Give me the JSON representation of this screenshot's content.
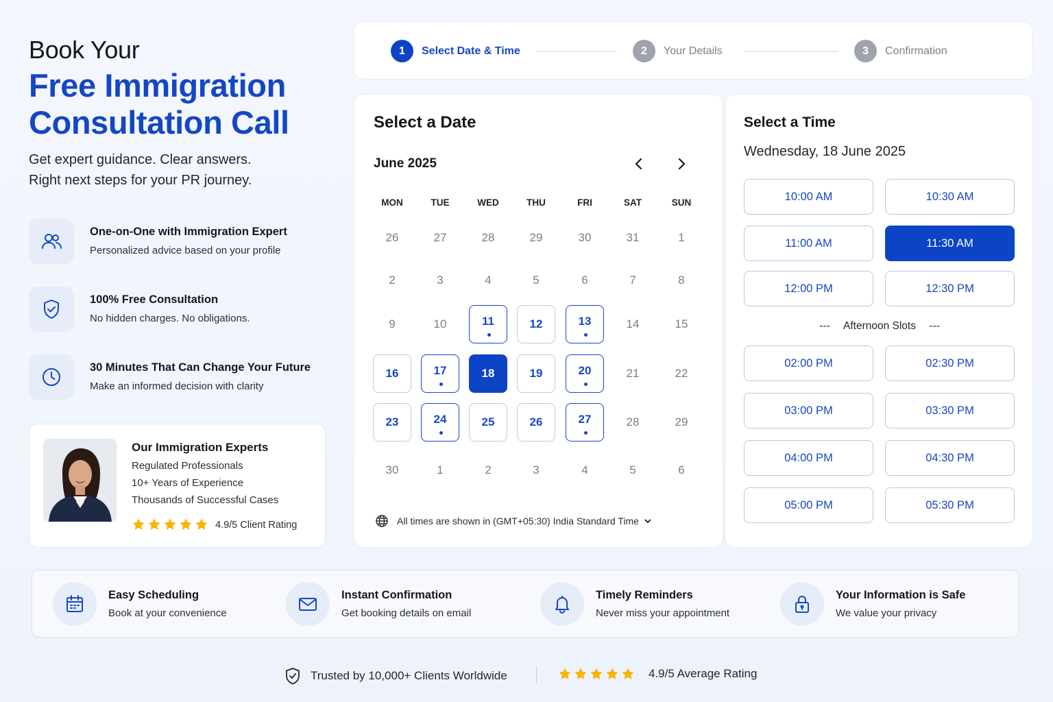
{
  "hero": {
    "pre_title": "Book Your",
    "title_line1": "Free Immigration",
    "title_line2": "Consultation Call",
    "subtitle_line1": "Get expert guidance. Clear answers.",
    "subtitle_line2": "Right next steps for your PR journey."
  },
  "features": [
    {
      "icon": "users-icon",
      "title": "One-on-One with Immigration Expert",
      "desc": "Personalized advice based on your profile"
    },
    {
      "icon": "shield-check-icon",
      "title": "100% Free Consultation",
      "desc": "No hidden charges. No obligations."
    },
    {
      "icon": "clock-icon",
      "title": "30 Minutes That Can Change Your Future",
      "desc": "Make an informed decision with clarity"
    }
  ],
  "experts": {
    "title": "Our Immigration Experts",
    "lines": [
      "Regulated Professionals",
      "10+ Years of Experience",
      "Thousands of Successful Cases"
    ],
    "stars": 5,
    "rating": "4.9/5 Client Rating"
  },
  "stepper": {
    "steps": [
      {
        "num": "1",
        "label": "Select Date & Time",
        "active": true
      },
      {
        "num": "2",
        "label": "Your Details",
        "active": false
      },
      {
        "num": "3",
        "label": "Confirmation",
        "active": false
      }
    ]
  },
  "calendar": {
    "title": "Select a Date",
    "month": "June 2025",
    "weekdays": [
      "MON",
      "TUE",
      "WED",
      "THU",
      "FRI",
      "SAT",
      "SUN"
    ],
    "weeks": [
      [
        "26",
        "27",
        "28",
        "29",
        "30",
        "31",
        "1"
      ],
      [
        "2",
        "3",
        "4",
        "5",
        "6",
        "7",
        "8"
      ],
      [
        "9",
        "10",
        "11",
        "12",
        "13",
        "14",
        "15"
      ],
      [
        "16",
        "17",
        "18",
        "19",
        "20",
        "21",
        "22"
      ],
      [
        "23",
        "24",
        "25",
        "26",
        "27",
        "28",
        "29"
      ],
      [
        "30",
        "1",
        "2",
        "3",
        "4",
        "5",
        "6"
      ]
    ],
    "available": [
      "11",
      "12",
      "13",
      "16",
      "17",
      "19",
      "20",
      "23",
      "24",
      "25",
      "26",
      "27"
    ],
    "highlighted": [
      "11",
      "13",
      "17",
      "20",
      "24",
      "27"
    ],
    "dotted": [
      "11",
      "13",
      "17",
      "20",
      "24",
      "27"
    ],
    "selected": "18",
    "timezone": "All times are shown in (GMT+05:30) India Standard Time"
  },
  "time": {
    "title": "Select a Time",
    "date": "Wednesday, 18 June 2025",
    "morning_slots": [
      "10:00 AM",
      "10:30 AM",
      "11:00 AM",
      "11:30 AM",
      "12:00 PM",
      "12:30 PM"
    ],
    "afternoon_label": "Afternoon Slots",
    "afternoon_dash": "---",
    "afternoon_slots": [
      "02:00 PM",
      "02:30 PM",
      "03:00 PM",
      "03:30 PM",
      "04:00 PM",
      "04:30 PM",
      "05:00 PM",
      "05:30 PM"
    ],
    "selected": "11:30 AM"
  },
  "benefits": [
    {
      "icon": "calendar-icon",
      "title": "Easy Scheduling",
      "desc": "Book at your convenience"
    },
    {
      "icon": "mail-icon",
      "title": "Instant Confirmation",
      "desc": "Get booking details on email"
    },
    {
      "icon": "bell-icon",
      "title": "Timely Reminders",
      "desc": "Never miss your appointment"
    },
    {
      "icon": "lock-icon",
      "title": "Your Information is Safe",
      "desc": "We value your privacy"
    }
  ],
  "trust": {
    "clients": "Trusted by 10,000+ Clients Worldwide",
    "stars": 5,
    "rating": "4.9/5 Average Rating"
  },
  "colors": {
    "primary": "#0d44c5",
    "primary_text": "#1547c3",
    "star": "#f7b500",
    "inactive_step": "#9ea3ad"
  }
}
